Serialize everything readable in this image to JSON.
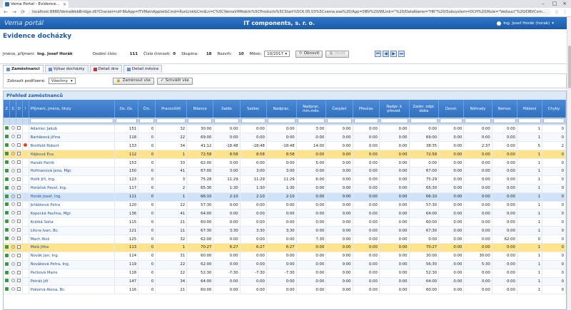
{
  "browser": {
    "tab_title": "Vema Portal - Evidence...",
    "url": "localhost:8880/VemaWebBridge.dll?Charset=utf-8&App=ITVMainApplet&Cmd=RunLink&CmdLn=C%5CVemaV4Mobiln%5CProducts%5CStart%5C6.05.03%5Cvema.exe%20/App=DBV%20/WLink=\"%20/DataName=\"HR\"%20/Subsystem=DCH%20/Role=\"Vedouci\"%20/DBVCom..."
  },
  "app": {
    "logo": "Vema",
    "logo_sub": "portál",
    "company": "IT components, s. r. o.",
    "user": "Ing. Josef Horák (horak)"
  },
  "page_title": "Evidence docházky",
  "info": {
    "name_label": "Jméno, příjmení:",
    "name_value": "Ing. Josef Horák",
    "personal_no_label": "Osobní číslo:",
    "personal_no_value": "111",
    "activity_no_label": "Číslo činnosti:",
    "activity_no_value": "0",
    "group_label": "Skupina:",
    "group_value": "18",
    "range_label": "Rozvrh:",
    "range_value": "10",
    "month_label": "Měsíc:",
    "month_value": "10/2017",
    "refresh_label": "Obnovit",
    "save_label": "Uložit"
  },
  "tabs": [
    {
      "label": "Zaměstnanci"
    },
    {
      "label": "Výkaz docházky"
    },
    {
      "label": "Detail dne"
    },
    {
      "label": "Detail měsíce"
    }
  ],
  "filter": {
    "show_label": "Zobrazit podřízené:",
    "show_value": "Všechny",
    "lock_all": "Zamknout vše",
    "approve_all": "Schválit vše"
  },
  "grid": {
    "title": "Přehled zaměstnanců",
    "columns": [
      "Z",
      "S",
      "D",
      "!",
      "Příjmení, jméno, tituly",
      "Os. čís.",
      "Čin.",
      "Pracovitští",
      "Bilance",
      "Saldo",
      "Saldoc",
      "Nadprac.",
      "Nadprac. min.měs.",
      "Čerpání",
      "Přesčas",
      "Nadpr. k převed.",
      "Zaokr. odpr. doba",
      "Dovol.",
      "Náhrady",
      "Nemoc",
      "Hlášení",
      "Chyby"
    ],
    "rows": [
      {
        "name": "Adamec Jakub",
        "os": "151",
        "cin": "0",
        "prac": "32",
        "bil": "30:00",
        "sal": "0:00",
        "salc": "0:00",
        "nad": "0:00",
        "nadm": "3:00",
        "cer": "0:00",
        "pre": "0:00",
        "npk": "0:00",
        "zao": "0:00",
        "dov": "0:00",
        "nah": "0:00",
        "nem": "0:00",
        "hla": "1",
        "chy": "0",
        "style": ""
      },
      {
        "name": "Bartáková Jiřina",
        "os": "118",
        "cin": "0",
        "prac": "22",
        "bil": "69:00",
        "sal": "0:00",
        "salc": "0:00",
        "nad": "0:00",
        "nadm": "0:00",
        "cer": "0:00",
        "pre": "0:00",
        "npk": "0:00",
        "zao": "69:00",
        "dov": "0:00",
        "nah": "0:00",
        "nem": "0:00",
        "hla": "1",
        "chy": "0",
        "style": "alt"
      },
      {
        "name": "Bretfeld Robert",
        "os": "133",
        "cin": "0",
        "prac": "34",
        "bil": "41:12",
        "sal": "-18:48",
        "salc": "-18:48",
        "nad": "-18:48",
        "nadm": "14:00",
        "cer": "0:00",
        "pre": "0:00",
        "npk": "0:00",
        "zao": "38:35",
        "dov": "0:00",
        "nah": "2:37",
        "nem": "0:00",
        "hla": "5",
        "chy": "2",
        "style": "",
        "warn": true
      },
      {
        "name": "Hájková Eva",
        "os": "112",
        "cin": "0",
        "prac": "1",
        "bil": "72:58",
        "sal": "8:58",
        "salc": "8:58",
        "nad": "8:58",
        "nadm": "0:00",
        "cer": "0:00",
        "pre": "0:00",
        "npk": "0:00",
        "zao": "72:58",
        "dov": "0:00",
        "nah": "0:00",
        "nem": "0:00",
        "hla": "1",
        "chy": "0",
        "style": "yellow"
      },
      {
        "name": "Hanák Patrik",
        "os": "153",
        "cin": "0",
        "prac": "33",
        "bil": "62:00",
        "sal": "0:00",
        "salc": "0:00",
        "nad": "0:00",
        "nadm": "5:00",
        "cer": "0:00",
        "pre": "0:00",
        "npk": "0:00",
        "zao": "0:00",
        "dov": "0:00",
        "nah": "0:00",
        "nem": "0:00",
        "hla": "1",
        "chy": "0",
        "style": ""
      },
      {
        "name": "Hofmanová Jana, Mgr.",
        "os": "150",
        "cin": "0",
        "prac": "41",
        "bil": "67:00",
        "sal": "3:00",
        "salc": "3:00",
        "nad": "3:00",
        "nadm": "0:00",
        "cer": "0:00",
        "pre": "0:00",
        "npk": "0:00",
        "zao": "67:00",
        "dov": "0:00",
        "nah": "0:00",
        "nem": "0:00",
        "hla": "1",
        "chy": "0",
        "style": "alt"
      },
      {
        "name": "Holík Jiří, Ing.",
        "os": "123",
        "cin": "0",
        "prac": "3",
        "bil": "75:28",
        "sal": "11:29",
        "salc": "11:29",
        "nad": "11:29",
        "nadm": "6:00",
        "cer": "0:00",
        "pre": "0:00",
        "npk": "0:00",
        "zao": "75:29",
        "dov": "0:00",
        "nah": "0:00",
        "nem": "0:00",
        "hla": "1",
        "chy": "0",
        "style": ""
      },
      {
        "name": "Horáček Pavel, Ing.",
        "os": "117",
        "cin": "0",
        "prac": "2",
        "bil": "65:30",
        "sal": "1:30",
        "salc": "1:30",
        "nad": "1:30",
        "nadm": "0:00",
        "cer": "0:00",
        "pre": "0:00",
        "npk": "0:00",
        "zao": "65:30",
        "dov": "0:00",
        "nah": "0:00",
        "nem": "0:00",
        "hla": "1",
        "chy": "0",
        "style": "alt"
      },
      {
        "name": "Horák Josef, Ing.",
        "os": "111",
        "cin": "0",
        "prac": "1",
        "bil": "66:10",
        "sal": "2:10",
        "salc": "2:10",
        "nad": "2:10",
        "nadm": "0:00",
        "cer": "0:00",
        "pre": "0:00",
        "npk": "0:00",
        "zao": "66:10",
        "dov": "0:00",
        "nah": "0:00",
        "nem": "0:00",
        "hla": "1",
        "chy": "0",
        "style": "blue"
      },
      {
        "name": "Jeřábková Petra",
        "os": "120",
        "cin": "0",
        "prac": "22",
        "bil": "57:30",
        "sal": "0:00",
        "salc": "0:00",
        "nad": "0:00",
        "nadm": "0:00",
        "cer": "0:00",
        "pre": "0:00",
        "npk": "0:00",
        "zao": "57:30",
        "dov": "0:00",
        "nah": "0:00",
        "nem": "0:00",
        "hla": "1",
        "chy": "0",
        "style": ""
      },
      {
        "name": "Kopecká Pavlína, Mgr.",
        "os": "136",
        "cin": "0",
        "prac": "41",
        "bil": "64:00",
        "sal": "0:00",
        "salc": "0:00",
        "nad": "0:00",
        "nadm": "0:00",
        "cer": "0:00",
        "pre": "0:00",
        "npk": "0:00",
        "zao": "64:00",
        "dov": "0:00",
        "nah": "0:00",
        "nem": "0:00",
        "hla": "1",
        "chy": "0",
        "style": "alt"
      },
      {
        "name": "Krátká Soňa",
        "os": "115",
        "cin": "0",
        "prac": "21",
        "bil": "60:00",
        "sal": "0:00",
        "salc": "0:00",
        "nad": "0:00",
        "nadm": "0:00",
        "cer": "0:00",
        "pre": "0:00",
        "npk": "0:00",
        "zao": "60:00",
        "dov": "0:00",
        "nah": "0:00",
        "nem": "0:00",
        "hla": "1",
        "chy": "0",
        "style": ""
      },
      {
        "name": "Litera Ivan, Bc.",
        "os": "121",
        "cin": "0",
        "prac": "11",
        "bil": "67:30",
        "sal": "3:30",
        "salc": "3:30",
        "nad": "3:30",
        "nadm": "0:00",
        "cer": "0:00",
        "pre": "0:00",
        "npk": "0:00",
        "zao": "67:30",
        "dov": "0:00",
        "nah": "0:00",
        "nem": "0:00",
        "hla": "1",
        "chy": "0",
        "style": "alt"
      },
      {
        "name": "Mach Aleš",
        "os": "125",
        "cin": "0",
        "prac": "32",
        "bil": "62:00",
        "sal": "0:00",
        "salc": "0:00",
        "nad": "0:00",
        "nadm": "7:30",
        "cer": "0:00",
        "pre": "0:00",
        "npk": "0:00",
        "zao": "0:00",
        "dov": "0:00",
        "nah": "0:00",
        "nem": "62:00",
        "hla": "0",
        "chy": "0",
        "style": ""
      },
      {
        "name": "Malá Jitka",
        "os": "113",
        "cin": "0",
        "prac": "1",
        "bil": "70:27",
        "sal": "6:27",
        "salc": "6:27",
        "nad": "6:27",
        "nadm": "0:00",
        "cer": "0:00",
        "pre": "0:00",
        "npk": "0:00",
        "zao": "70:27",
        "dov": "0:00",
        "nah": "0:00",
        "nem": "0:00",
        "hla": "1",
        "chy": "0",
        "style": "yellow"
      },
      {
        "name": "Novák Jan, Ing.",
        "os": "114",
        "cin": "0",
        "prac": "31",
        "bil": "60:00",
        "sal": "0:00",
        "salc": "0:00",
        "nad": "0:00",
        "nadm": "0:00",
        "cer": "0:00",
        "pre": "0:00",
        "npk": "0:00",
        "zao": "30:00",
        "dov": "0:00",
        "nah": "30:00",
        "nem": "0:00",
        "hla": "1",
        "chy": "0",
        "style": ""
      },
      {
        "name": "Nováková Petra, Ing.",
        "os": "119",
        "cin": "0",
        "prac": "22",
        "bil": "62:00",
        "sal": "0:00",
        "salc": "0:00",
        "nad": "0:00",
        "nadm": "0:00",
        "cer": "0:00",
        "pre": "0:00",
        "npk": "0:00",
        "zao": "56:30",
        "dov": "0:00",
        "nah": "5:30",
        "nem": "0:00",
        "hla": "1",
        "chy": "0",
        "style": "alt"
      },
      {
        "name": "Pečková Marie",
        "os": "118",
        "cin": "0",
        "prac": "22",
        "bil": "52:30",
        "sal": "-7:30",
        "salc": "-7:30",
        "nad": "-7:30",
        "nadm": "0:00",
        "cer": "0:00",
        "pre": "0:00",
        "npk": "0:00",
        "zao": "52:30",
        "dov": "0:00",
        "nah": "0:00",
        "nem": "0:00",
        "hla": "1",
        "chy": "0",
        "style": ""
      },
      {
        "name": "Petráš Jiří",
        "os": "147",
        "cin": "0",
        "prac": "34",
        "bil": "64:00",
        "sal": "0:00",
        "salc": "0:00",
        "nad": "0:00",
        "nadm": "0:00",
        "cer": "0:00",
        "pre": "0:00",
        "npk": "0:00",
        "zao": "64:00",
        "dov": "0:00",
        "nah": "0:00",
        "nem": "0:00",
        "hla": "1",
        "chy": "0",
        "style": "alt"
      },
      {
        "name": "Pokorná Alena, Bc.",
        "os": "116",
        "cin": "0",
        "prac": "21",
        "bil": "60:00",
        "sal": "0:00",
        "salc": "0:00",
        "nad": "0:00",
        "nadm": "0:00",
        "cer": "0:00",
        "pre": "0:00",
        "npk": "0:00",
        "zao": "60:00",
        "dov": "0:00",
        "nah": "0:00",
        "nem": "0:00",
        "hla": "1",
        "chy": "0",
        "style": ""
      }
    ]
  }
}
